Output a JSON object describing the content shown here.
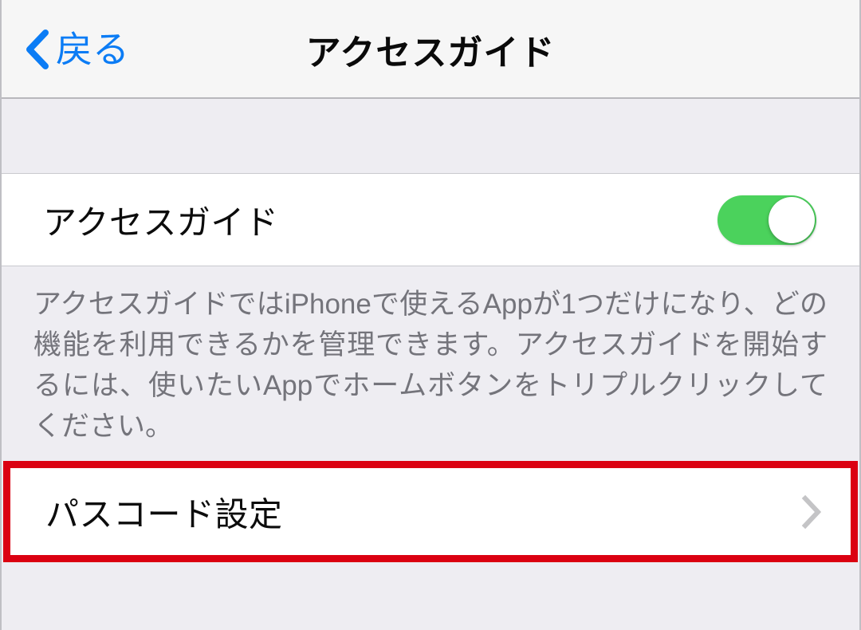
{
  "navbar": {
    "back_label": "戻る",
    "back_icon": "chevron-left-icon",
    "title": "アクセスガイド",
    "title_color": "#0A0A0A",
    "tint_color": "#0B7CF5",
    "background_color": "#F6F6F6"
  },
  "sections": {
    "toggle_section": {
      "row": {
        "label": "アクセスガイド",
        "control": "switch",
        "switch_state": "on",
        "switch_on_color": "#4BD25C",
        "switch_knob_color": "#FFFFFF"
      },
      "footer": "アクセスガイドではiPhoneで使えるAppが1つだけになり、どの機能を利用できるかを管理できます。アクセスガイドを開始するには、使いたいAppでホームボタンをトリプルクリックしてください。",
      "footer_color": "#74747B"
    },
    "passcode_section": {
      "row": {
        "label": "パスコード設定",
        "accessory": "chevron-right-icon",
        "accessory_color": "#C4C4C6"
      },
      "highlight_color": "#DB0011",
      "highlighted": "true"
    }
  },
  "page_background": "#EEEDF2",
  "cell_background": "#FFFFFF",
  "separator_color": "#C9C9CE"
}
